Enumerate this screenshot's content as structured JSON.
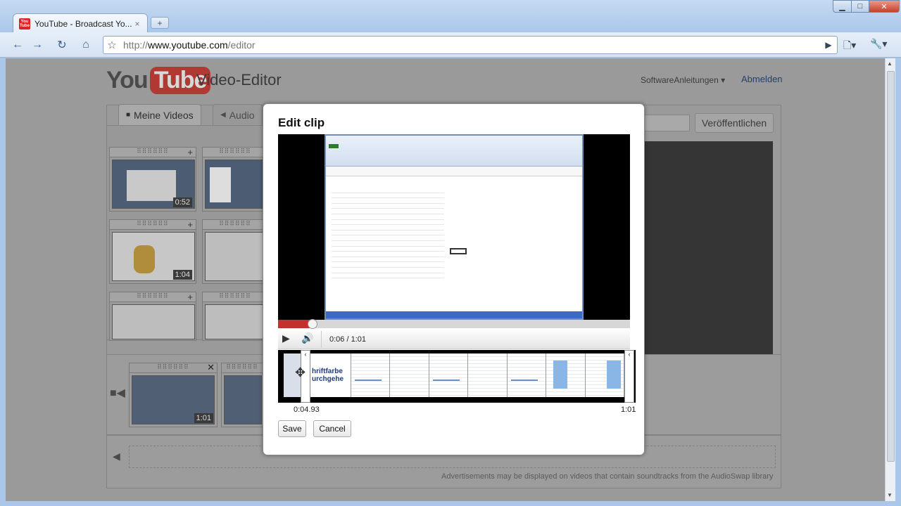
{
  "browser": {
    "tab_title": "YouTube - Broadcast Yo...",
    "favicon_text": "You Tube",
    "tab_close": "×",
    "new_tab": "+",
    "window": {
      "minimize": "▁",
      "maximize": "□",
      "close": "✕"
    },
    "url_prefix": "http://",
    "url_host": "www.youtube.com",
    "url_path": "/editor",
    "icons": {
      "back": "←",
      "forward": "→",
      "reload": "↻",
      "home": "⌂",
      "star": "☆",
      "go": "▶",
      "page": "🗋▾",
      "wrench": "🔧▾"
    }
  },
  "header": {
    "logo_you": "You",
    "logo_tube": "Tube",
    "title": "Video-Editor",
    "user": "SoftwareAnleitungen ▾",
    "logout": "Abmelden",
    "publish": "Veröffentlichen"
  },
  "tabs": {
    "my_videos": "Meine Videos",
    "audio": "Audio",
    "my_videos_icon": "■",
    "audio_icon": "◀"
  },
  "library": [
    {
      "duration": "0:52"
    },
    {
      "duration": ""
    },
    {
      "duration": "1:04"
    },
    {
      "duration": ""
    },
    {
      "duration": ""
    },
    {
      "duration": ""
    }
  ],
  "card_icons": {
    "handle": "⠿⠿⠿⠿⠿⠿",
    "add": "+",
    "remove": "✕"
  },
  "timeline": {
    "camera_icon": "■◀",
    "clip_duration": "1:01",
    "speaker_icon": "◀",
    "ad_note": "Advertisements may be displayed on videos that contain soundtracks from the AudioSwap library"
  },
  "dialog": {
    "title": "Edit clip",
    "time_display": "0:06 / 1:01",
    "progress": 0.1,
    "play_icon": "▶",
    "volume_icon": "🔊",
    "filmstrip_text": "hriftfarbe urchgehe",
    "trim_start": "0:04.93",
    "trim_end": "1:01",
    "save": "Save",
    "cancel": "Cancel",
    "handle_left": "‹",
    "handle_right": "‹",
    "move_icon": "✥"
  }
}
